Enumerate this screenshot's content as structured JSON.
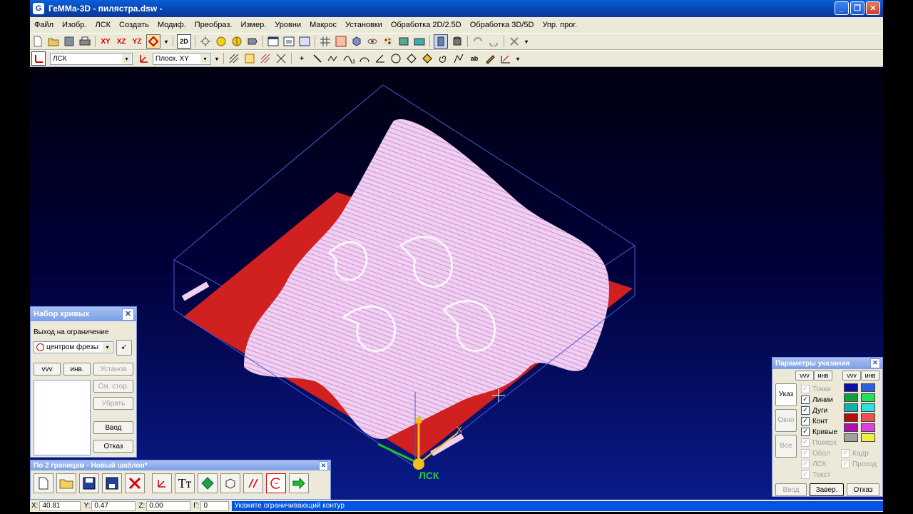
{
  "window": {
    "title": "ГеММа-3D - пилястра.dsw -",
    "app_icon": "G",
    "controls": [
      "_",
      "❐",
      "✕"
    ]
  },
  "menu": [
    "Файл",
    "Изобр.",
    "ЛСК",
    "Создать",
    "Модиф.",
    "Преобраз.",
    "Измер.",
    "Уровни",
    "Макрос",
    "Установки",
    "Обработка 2D/2.5D",
    "Обработка 3D/5D",
    "Упр. прог."
  ],
  "toolbar1": {
    "xy": "XY",
    "xz": "XZ",
    "yz": "YZ",
    "two_d": "2D"
  },
  "toolbar2": {
    "lsk_combo": "ЛСК",
    "plane_combo": "Плоск. XY"
  },
  "viewport": {
    "lsk_label": "ЛСК",
    "x_label": "X"
  },
  "curves_panel": {
    "title": "Набор кривых",
    "exit_label": "Выход на ограничение",
    "combo_value": "центром фрезы",
    "vvv": "vvv",
    "inv": "инв.",
    "install": "Установ",
    "change_side": "См. стор.",
    "remove": "Убрать",
    "enter": "Ввод",
    "cancel": "Отказ"
  },
  "template_panel": {
    "title": "По 2 границам - Новый шаблон*"
  },
  "params_panel": {
    "title": "Параметры указания",
    "vvv": "vvv",
    "inv": "инв",
    "tabs": [
      "Указ",
      "Окно",
      "Все"
    ],
    "checks": [
      {
        "label": "Точки",
        "checked": true,
        "enabled": false
      },
      {
        "label": "Линии",
        "checked": true,
        "enabled": true
      },
      {
        "label": "Дуги",
        "checked": true,
        "enabled": true
      },
      {
        "label": "Конт",
        "checked": true,
        "enabled": true
      },
      {
        "label": "Кривые",
        "checked": true,
        "enabled": true
      },
      {
        "label": "Поверх",
        "checked": true,
        "enabled": false
      },
      {
        "label": "Обол",
        "checked": true,
        "enabled": false
      },
      {
        "label": "ЛСК",
        "checked": true,
        "enabled": false
      },
      {
        "label": "Текст",
        "checked": true,
        "enabled": false
      }
    ],
    "checks_right": [
      {
        "label": "Кадр",
        "checked": true,
        "enabled": false
      },
      {
        "label": "Проход",
        "checked": true,
        "enabled": false
      }
    ],
    "swatches": [
      "#1010a0",
      "#3060e0",
      "#10a040",
      "#20e060",
      "#10b0b0",
      "#30e0e0",
      "#b01010",
      "#f05050",
      "#b010b0",
      "#e040e0",
      "#a0a0a0",
      "#f0f040"
    ],
    "enter": "Ввод",
    "finish": "Завер.",
    "cancel": "Отказ"
  },
  "status": {
    "x_label": "X:",
    "x_value": "40.81",
    "y_label": "Y:",
    "y_value": "0.47",
    "z_label": "Z:",
    "z_value": "0.00",
    "g_label": "Г:",
    "g_value": "0",
    "message": "Укажите ограничивающий контур"
  }
}
